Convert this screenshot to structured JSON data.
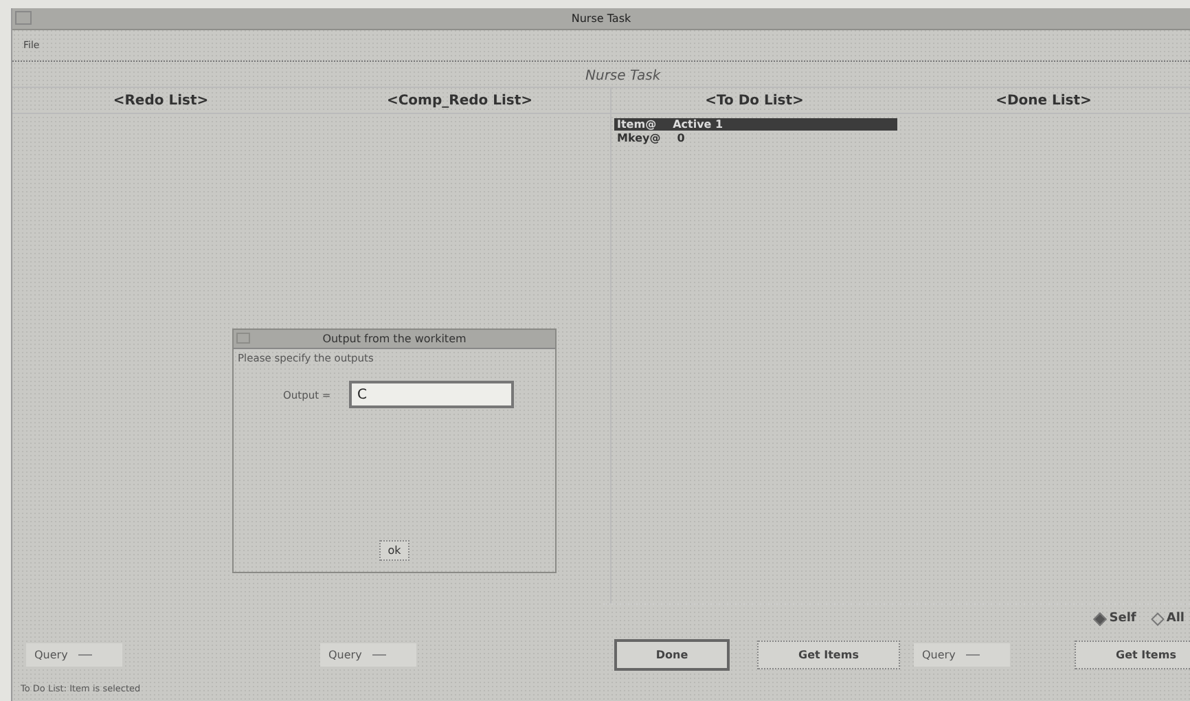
{
  "window": {
    "title": "Nurse Task"
  },
  "menu": [
    {
      "label": "File"
    }
  ],
  "heading": "Nurse Task",
  "columns": [
    {
      "header": "<Redo List>"
    },
    {
      "header": "<Comp_Redo List>"
    },
    {
      "header": "<To Do List>",
      "items": [
        {
          "label": "Item@",
          "value": "Active 1",
          "selected": true
        },
        {
          "label": "Mkey@",
          "value": "0",
          "selected": false
        }
      ]
    },
    {
      "header": "<Done List>"
    }
  ],
  "dialog": {
    "title": "Output from the workitem",
    "prompt": "Please specify the outputs",
    "fields": [
      {
        "label": "Output =",
        "value": "C"
      }
    ],
    "button": "ok"
  },
  "radios": [
    {
      "label": "Self",
      "selected": true
    },
    {
      "label": "All",
      "selected": false
    }
  ],
  "controls": [
    {
      "kind": "option",
      "label": "Query"
    },
    {
      "kind": "option",
      "label": "Query"
    },
    {
      "kind": "button",
      "label": "Done",
      "default": true
    },
    {
      "kind": "button",
      "label": "Get Items",
      "default": false
    },
    {
      "kind": "option",
      "label": "Query"
    },
    {
      "kind": "button",
      "label": "Get Items",
      "default": false
    }
  ],
  "status": "To Do List: Item is selected"
}
